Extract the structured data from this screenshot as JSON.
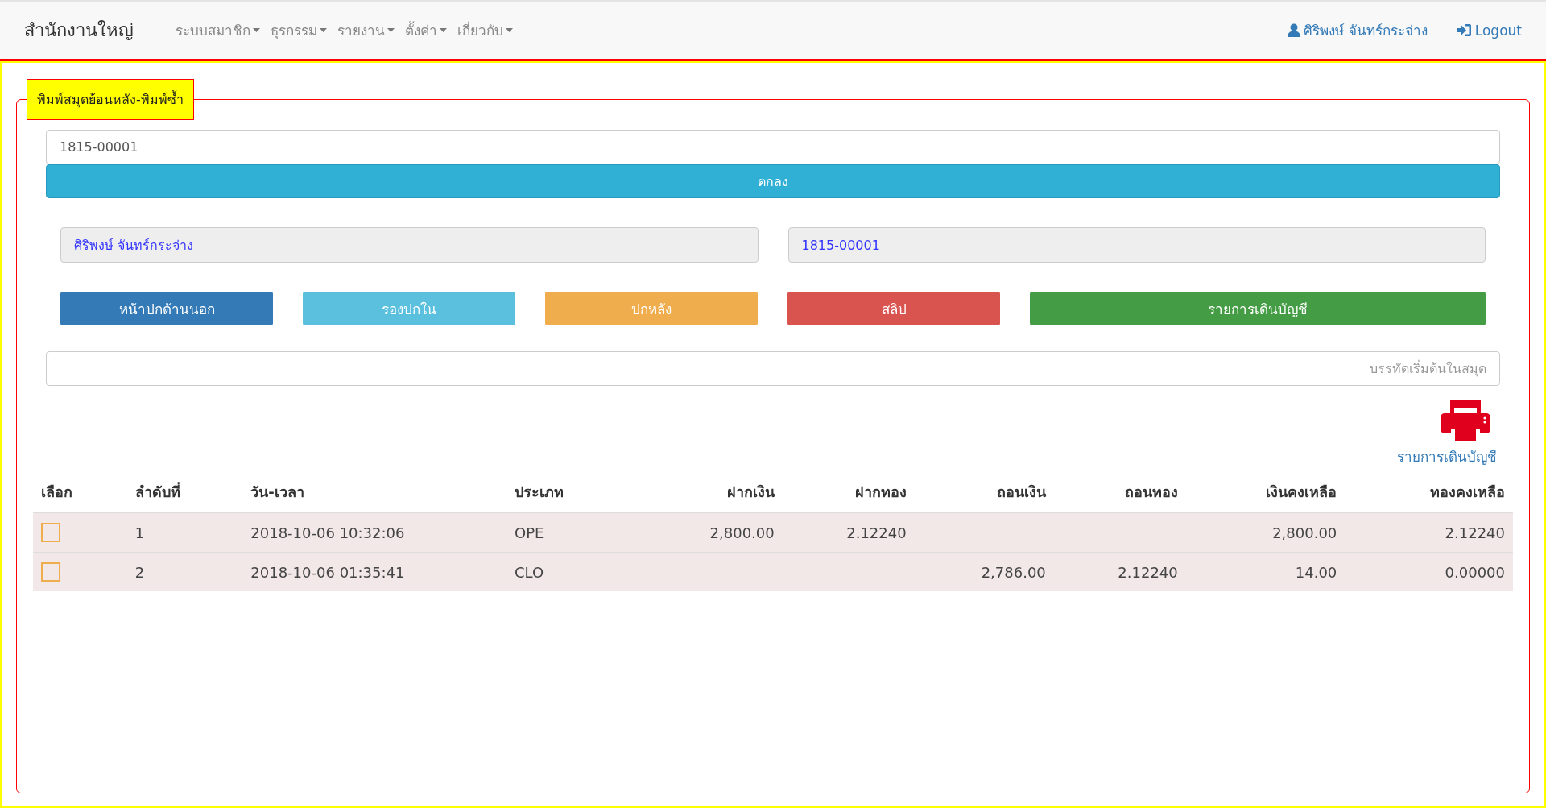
{
  "navbar": {
    "brand": "สำนักงานใหญ่",
    "menus": [
      {
        "label": "ระบบสมาชิก"
      },
      {
        "label": "ธุรกรรม"
      },
      {
        "label": "รายงาน"
      },
      {
        "label": "ตั้งค่า"
      },
      {
        "label": "เกี่ยวกับ"
      }
    ],
    "user": "ศิริพงษ์ จันทร์กระจ่าง",
    "logout": "Logout"
  },
  "panel": {
    "legend": "พิมพ์สมุดย้อนหลัง-พิมพ์ซ้ำ",
    "account_input": {
      "value": "1815-00001"
    },
    "submit": "ตกลง",
    "member_name": "ศิริพงษ์ จันทร์กระจ่าง",
    "member_account": "1815-00001",
    "buttons": [
      {
        "label": "หน้าปกด้านนอก",
        "kind": "primary"
      },
      {
        "label": "รองปกใน",
        "kind": "info"
      },
      {
        "label": "ปกหลัง",
        "kind": "warning"
      },
      {
        "label": "สลิป",
        "kind": "danger"
      },
      {
        "label": "รายการเดินบัญชี",
        "kind": "success"
      }
    ],
    "start_line": {
      "placeholder": "บรรทัดเริ่มต้นในสมุด"
    },
    "print_link": "รายการเดินบัญชี",
    "table": {
      "columns": [
        "เลือก",
        "ลำดับที่",
        "วัน-เวลา",
        "ประเภท",
        "ฝากเงิน",
        "ฝากทอง",
        "ถอนเงิน",
        "ถอนทอง",
        "เงินคงเหลือ",
        "ทองคงเหลือ"
      ],
      "rows": [
        {
          "checked": false,
          "cells": [
            "",
            "1",
            "2018-10-06 10:32:06",
            "OPE",
            "2,800.00",
            "2.12240",
            "",
            "",
            "2,800.00",
            "2.12240"
          ]
        },
        {
          "checked": false,
          "cells": [
            "",
            "2",
            "2018-10-06 01:35:41",
            "CLO",
            "",
            "",
            "2,786.00",
            "2.12240",
            "14.00",
            "0.00000"
          ]
        }
      ]
    }
  }
}
